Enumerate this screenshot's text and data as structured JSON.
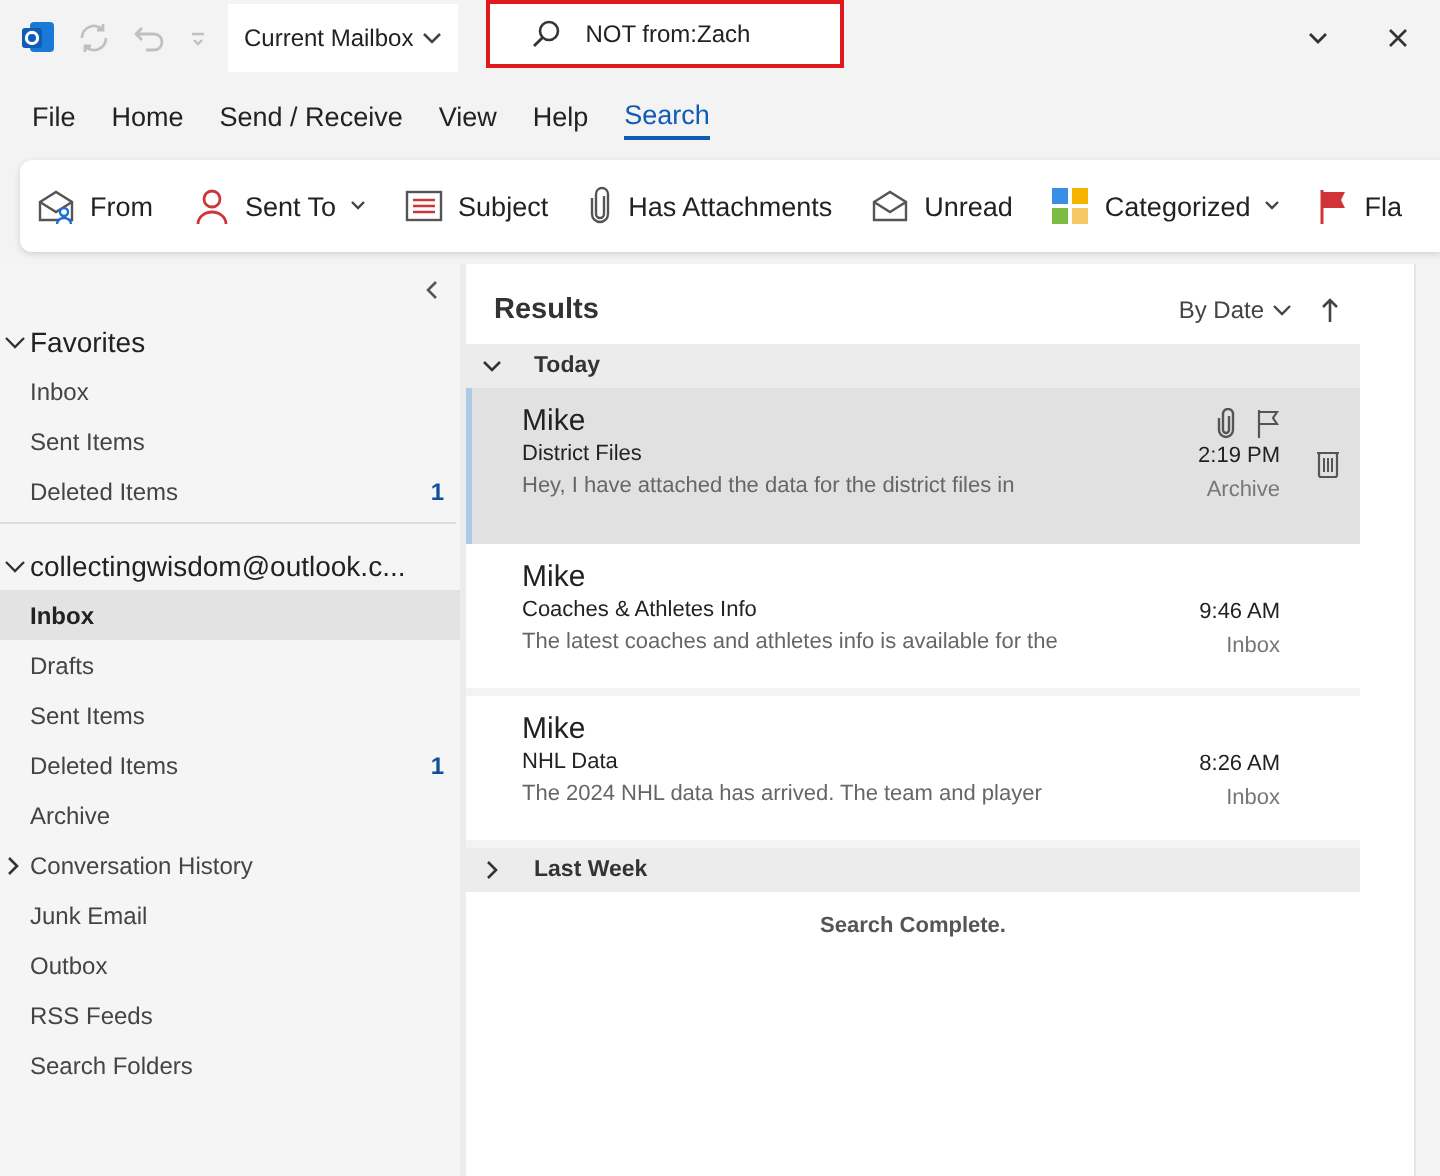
{
  "title_bar": {
    "scope": "Current Mailbox",
    "search": {
      "value": "NOT from:Zach"
    }
  },
  "menu_tabs": [
    {
      "label": "File",
      "selected": false
    },
    {
      "label": "Home",
      "selected": false
    },
    {
      "label": "Send / Receive",
      "selected": false
    },
    {
      "label": "View",
      "selected": false
    },
    {
      "label": "Help",
      "selected": false
    },
    {
      "label": "Search",
      "selected": true
    }
  ],
  "ribbon": [
    {
      "kind": "from",
      "label": "From",
      "dropdown": false
    },
    {
      "kind": "sent_to",
      "label": "Sent To",
      "dropdown": true
    },
    {
      "kind": "subject",
      "label": "Subject",
      "dropdown": false
    },
    {
      "kind": "attachments",
      "label": "Has Attachments",
      "dropdown": false
    },
    {
      "kind": "unread",
      "label": "Unread",
      "dropdown": false
    },
    {
      "kind": "categorized",
      "label": "Categorized",
      "dropdown": true
    },
    {
      "kind": "flag",
      "label": "Fla",
      "dropdown": false
    }
  ],
  "sidebar": {
    "sections": [
      {
        "label": "Favorites",
        "expanded": true,
        "items": [
          {
            "label": "Inbox",
            "selected": false,
            "collapsed": false
          },
          {
            "label": "Sent Items",
            "selected": false,
            "collapsed": false
          },
          {
            "label": "Deleted Items",
            "count": "1",
            "selected": false,
            "collapsed": false
          }
        ]
      },
      {
        "label": "collectingwisdom@outlook.c...",
        "expanded": true,
        "items": [
          {
            "label": "Inbox",
            "selected": true,
            "collapsed": false
          },
          {
            "label": "Drafts",
            "selected": false,
            "collapsed": false
          },
          {
            "label": "Sent Items",
            "selected": false,
            "collapsed": false
          },
          {
            "label": "Deleted Items",
            "count": "1",
            "selected": false,
            "collapsed": false
          },
          {
            "label": "Archive",
            "selected": false,
            "collapsed": false
          },
          {
            "label": "Conversation History",
            "selected": false,
            "collapsed": true
          },
          {
            "label": "Junk Email",
            "selected": false,
            "collapsed": false
          },
          {
            "label": "Outbox",
            "selected": false,
            "collapsed": false
          },
          {
            "label": "RSS Feeds",
            "selected": false,
            "collapsed": false
          },
          {
            "label": "Search Folders",
            "selected": false,
            "collapsed": false
          }
        ]
      }
    ]
  },
  "results": {
    "title": "Results",
    "sort": "By Date",
    "groups": [
      {
        "label": "Today",
        "expanded": true,
        "messages": [
          {
            "sender": "Mike",
            "subject": "District Files",
            "preview": "Hey, I have attached the data for the district files in",
            "time": "2:19 PM",
            "folder": "Archive",
            "selected": true,
            "attachment": true
          },
          {
            "sender": "Mike",
            "subject": "Coaches & Athletes Info",
            "preview": "The latest coaches and athletes info is available for the",
            "time": "9:46 AM",
            "folder": "Inbox",
            "selected": false,
            "attachment": false
          },
          {
            "sender": "Mike",
            "subject": "NHL Data",
            "preview": "The 2024 NHL data has arrived.  The team and player",
            "time": "8:26 AM",
            "folder": "Inbox",
            "selected": false,
            "attachment": false
          }
        ]
      },
      {
        "label": "Last Week",
        "expanded": false
      }
    ],
    "status": "Search Complete."
  }
}
